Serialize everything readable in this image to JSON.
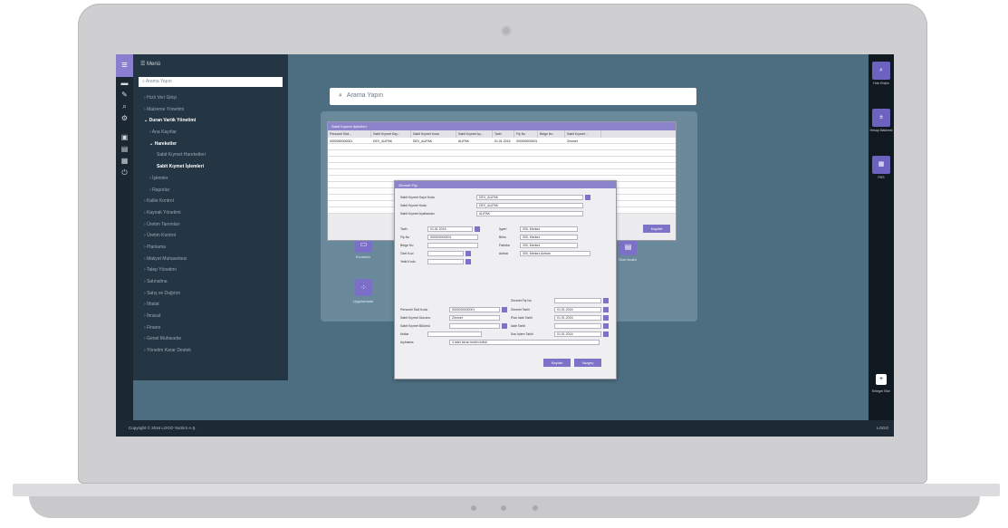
{
  "menu": {
    "title": "Menü",
    "search_placeholder": "Arama Yapın",
    "items": [
      {
        "label": "Hızlı Veri Girişi",
        "level": 1
      },
      {
        "label": "Malzeme Yönetimi",
        "level": 1
      },
      {
        "label": "Duran Varlık Yönetimi",
        "level": 1,
        "bold": true
      },
      {
        "label": "Ana Kayıtlar",
        "level": 2
      },
      {
        "label": "Hareketler",
        "level": 2,
        "bold": true
      },
      {
        "label": "Sabit Kıymet Hareketleri",
        "level": 3
      },
      {
        "label": "Sabit Kıymet İşlemleri",
        "level": 3,
        "bold": true
      },
      {
        "label": "İşlemler",
        "level": 2
      },
      {
        "label": "Raporlar",
        "level": 2
      },
      {
        "label": "Kalite Kontrol",
        "level": 1
      },
      {
        "label": "Kaynak Yönetimi",
        "level": 1
      },
      {
        "label": "Üretim Tanımları",
        "level": 1
      },
      {
        "label": "Üretim Kontrol",
        "level": 1
      },
      {
        "label": "Planlama",
        "level": 1
      },
      {
        "label": "Maliyet Muhasebesi",
        "level": 1
      },
      {
        "label": "Talep Yönetimi",
        "level": 1
      },
      {
        "label": "Satınalma",
        "level": 1
      },
      {
        "label": "Satış ve Dağıtım",
        "level": 1
      },
      {
        "label": "İthalat",
        "level": 1
      },
      {
        "label": "İhracat",
        "level": 1
      },
      {
        "label": "Finans",
        "level": 1
      },
      {
        "label": "Genel Muhasebe",
        "level": 1
      },
      {
        "label": "Yönetim Karar Destek",
        "level": 1
      }
    ]
  },
  "main": {
    "search_placeholder": "Arama Yapın",
    "tiles": [
      {
        "label": "Envanter"
      },
      {
        "label": "Uygulamalar"
      },
      {
        "label": "Özet Analiz"
      }
    ]
  },
  "right_rail": [
    {
      "label": "Hızlı Erişim"
    },
    {
      "label": "Hesap Makinesi"
    },
    {
      "label": "RSS"
    },
    {
      "label": "Entegre Ekle"
    }
  ],
  "status_bar": {
    "copyright": "Copyright © 2016 LOGO Yazılım A.Ş.",
    "right": "LOGO"
  },
  "list_window": {
    "title": "Sabit Kıymet İşlemleri",
    "columns": [
      "Personel Sicil...",
      "Sabit Kıymet Kay...",
      "Sabit Kıymet Kodu",
      "Sabit Kıymet Aç...",
      "Tarih",
      "Fiş No",
      "Belge No",
      "Sabit Kıymet ..."
    ],
    "rows": [
      [
        "0000000000001",
        "DEV_ALİPAK",
        "DEV_ALİPAK",
        "ALİPAK",
        "01.01.2016",
        "000000000001",
        "",
        "Zimmet"
      ]
    ],
    "button": "Kaydet"
  },
  "form_window": {
    "title": "Zimmet Fişi",
    "fields": {
      "asset_record_code_label": "Sabit Kıymet Kayıt Kodu",
      "asset_record_code_value": "DEV_ALİPAK",
      "asset_code_label": "Sabit Kıymet Kodu",
      "asset_code_value": "DEV_ALİPAK",
      "asset_desc_label": "Sabit Kıymet Açıklaması",
      "asset_desc_value": "ALİPAK",
      "date_label": "Tarih",
      "date_value": "01.01.2016",
      "slip_no_label": "Fiş No",
      "slip_no_value": "000000000001",
      "doc_no_label": "Belge No",
      "special_code_label": "Özel Kod",
      "auth_code_label": "Yetki Kodu",
      "workplace_label": "İşyeri",
      "workplace_value": "000, Merkez",
      "unit_label": "Birim",
      "unit_value": "000, Merkez",
      "factory_label": "Fabrika",
      "factory_value": "000, Merkez",
      "warehouse_label": "Ambar",
      "warehouse_value": "000, Merkez Ambarı",
      "personnel_label": "Personel Sicil Kodu",
      "personnel_value": "0000000000001",
      "asset_status_label": "Sabit Kıymet Durumu",
      "asset_status_value": "Zimmet",
      "asset_location_label": "Sabit Kıymet Bölümü",
      "notes_label": "Notlar",
      "explanation_label": "Açıklama",
      "explanation_value": "4 adet ekran teslim edildi",
      "slip_no2_label": "Zimmet Fiş No",
      "zimmet_date_label": "Zimmet Tarihi",
      "zimmet_date_value": "01.01.2016",
      "plan_return_label": "Plan İade Tarihi",
      "plan_return_value": "01.01.2016",
      "return_date_label": "İade Tarihi",
      "last_op_label": "Son İşlem Tarihi",
      "last_op_value": "01.01.2016"
    },
    "save_button": "Kaydet",
    "cancel_button": "Vazgeç"
  }
}
